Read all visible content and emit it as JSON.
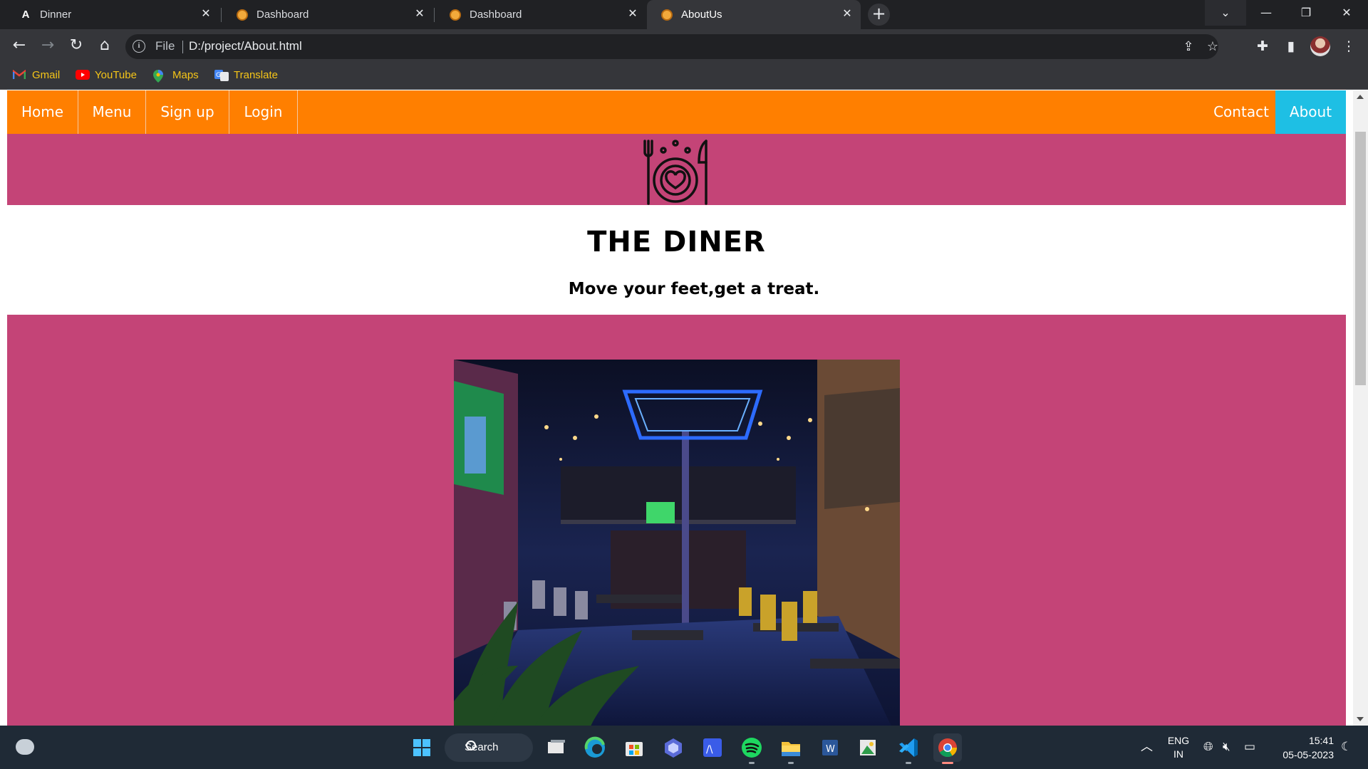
{
  "browser": {
    "tabs": [
      {
        "title": "Dinner",
        "favicon": "angular-a-icon",
        "active": false
      },
      {
        "title": "Dashboard",
        "favicon": "orange-globe-icon",
        "active": false
      },
      {
        "title": "Dashboard",
        "favicon": "orange-globe-icon",
        "active": false
      },
      {
        "title": "AboutUs",
        "favicon": "orange-globe-icon",
        "active": true
      }
    ],
    "address": {
      "scheme_label": "File",
      "url": "D:/project/About.html"
    },
    "bookmarks": [
      {
        "label": "Gmail",
        "icon": "gmail-icon"
      },
      {
        "label": "YouTube",
        "icon": "youtube-icon"
      },
      {
        "label": "Maps",
        "icon": "maps-pin-icon"
      },
      {
        "label": "Translate",
        "icon": "translate-icon"
      }
    ]
  },
  "site": {
    "nav": {
      "left": [
        "Home",
        "Menu",
        "Sign up",
        "Login"
      ],
      "right": [
        "Contact",
        "About"
      ],
      "active": "About"
    },
    "title": "THE DINER",
    "tagline": "Move your feet,get a treat.",
    "colors": {
      "nav_bg": "#ff7f00",
      "nav_active": "#1ebfe4",
      "band_bg": "#c44477"
    }
  },
  "taskbar": {
    "search_label": "Search",
    "language": {
      "line1": "ENG",
      "line2": "IN"
    },
    "time": "15:41",
    "date": "05-05-2023"
  }
}
